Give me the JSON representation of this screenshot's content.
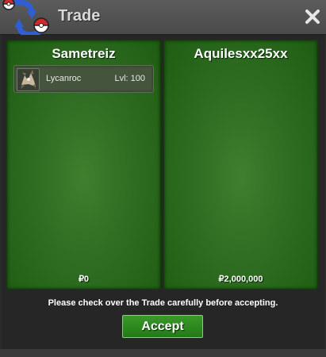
{
  "window": {
    "title": "Trade"
  },
  "icons": {
    "logo": "pokeball-arrows-logo-icon",
    "close": "close-icon",
    "pokemon": "lycanroc-sprite-icon",
    "currency": "pokedollar-icon"
  },
  "trade": {
    "left": {
      "player_name": "Sametreiz",
      "pokemon": [
        {
          "name": "Lycanroc",
          "level": "Lvl: 100"
        }
      ],
      "money": "₽0"
    },
    "right": {
      "player_name": "Aquilesxx25xx",
      "pokemon": [],
      "money": "₽2,000,000"
    }
  },
  "notice": "Please check over the Trade carefully before accepting.",
  "accept_label": "Accept",
  "colors": {
    "panel_green": "#2f6d22",
    "accept_green": "#2b8a1f",
    "titlebar": "#545454"
  }
}
